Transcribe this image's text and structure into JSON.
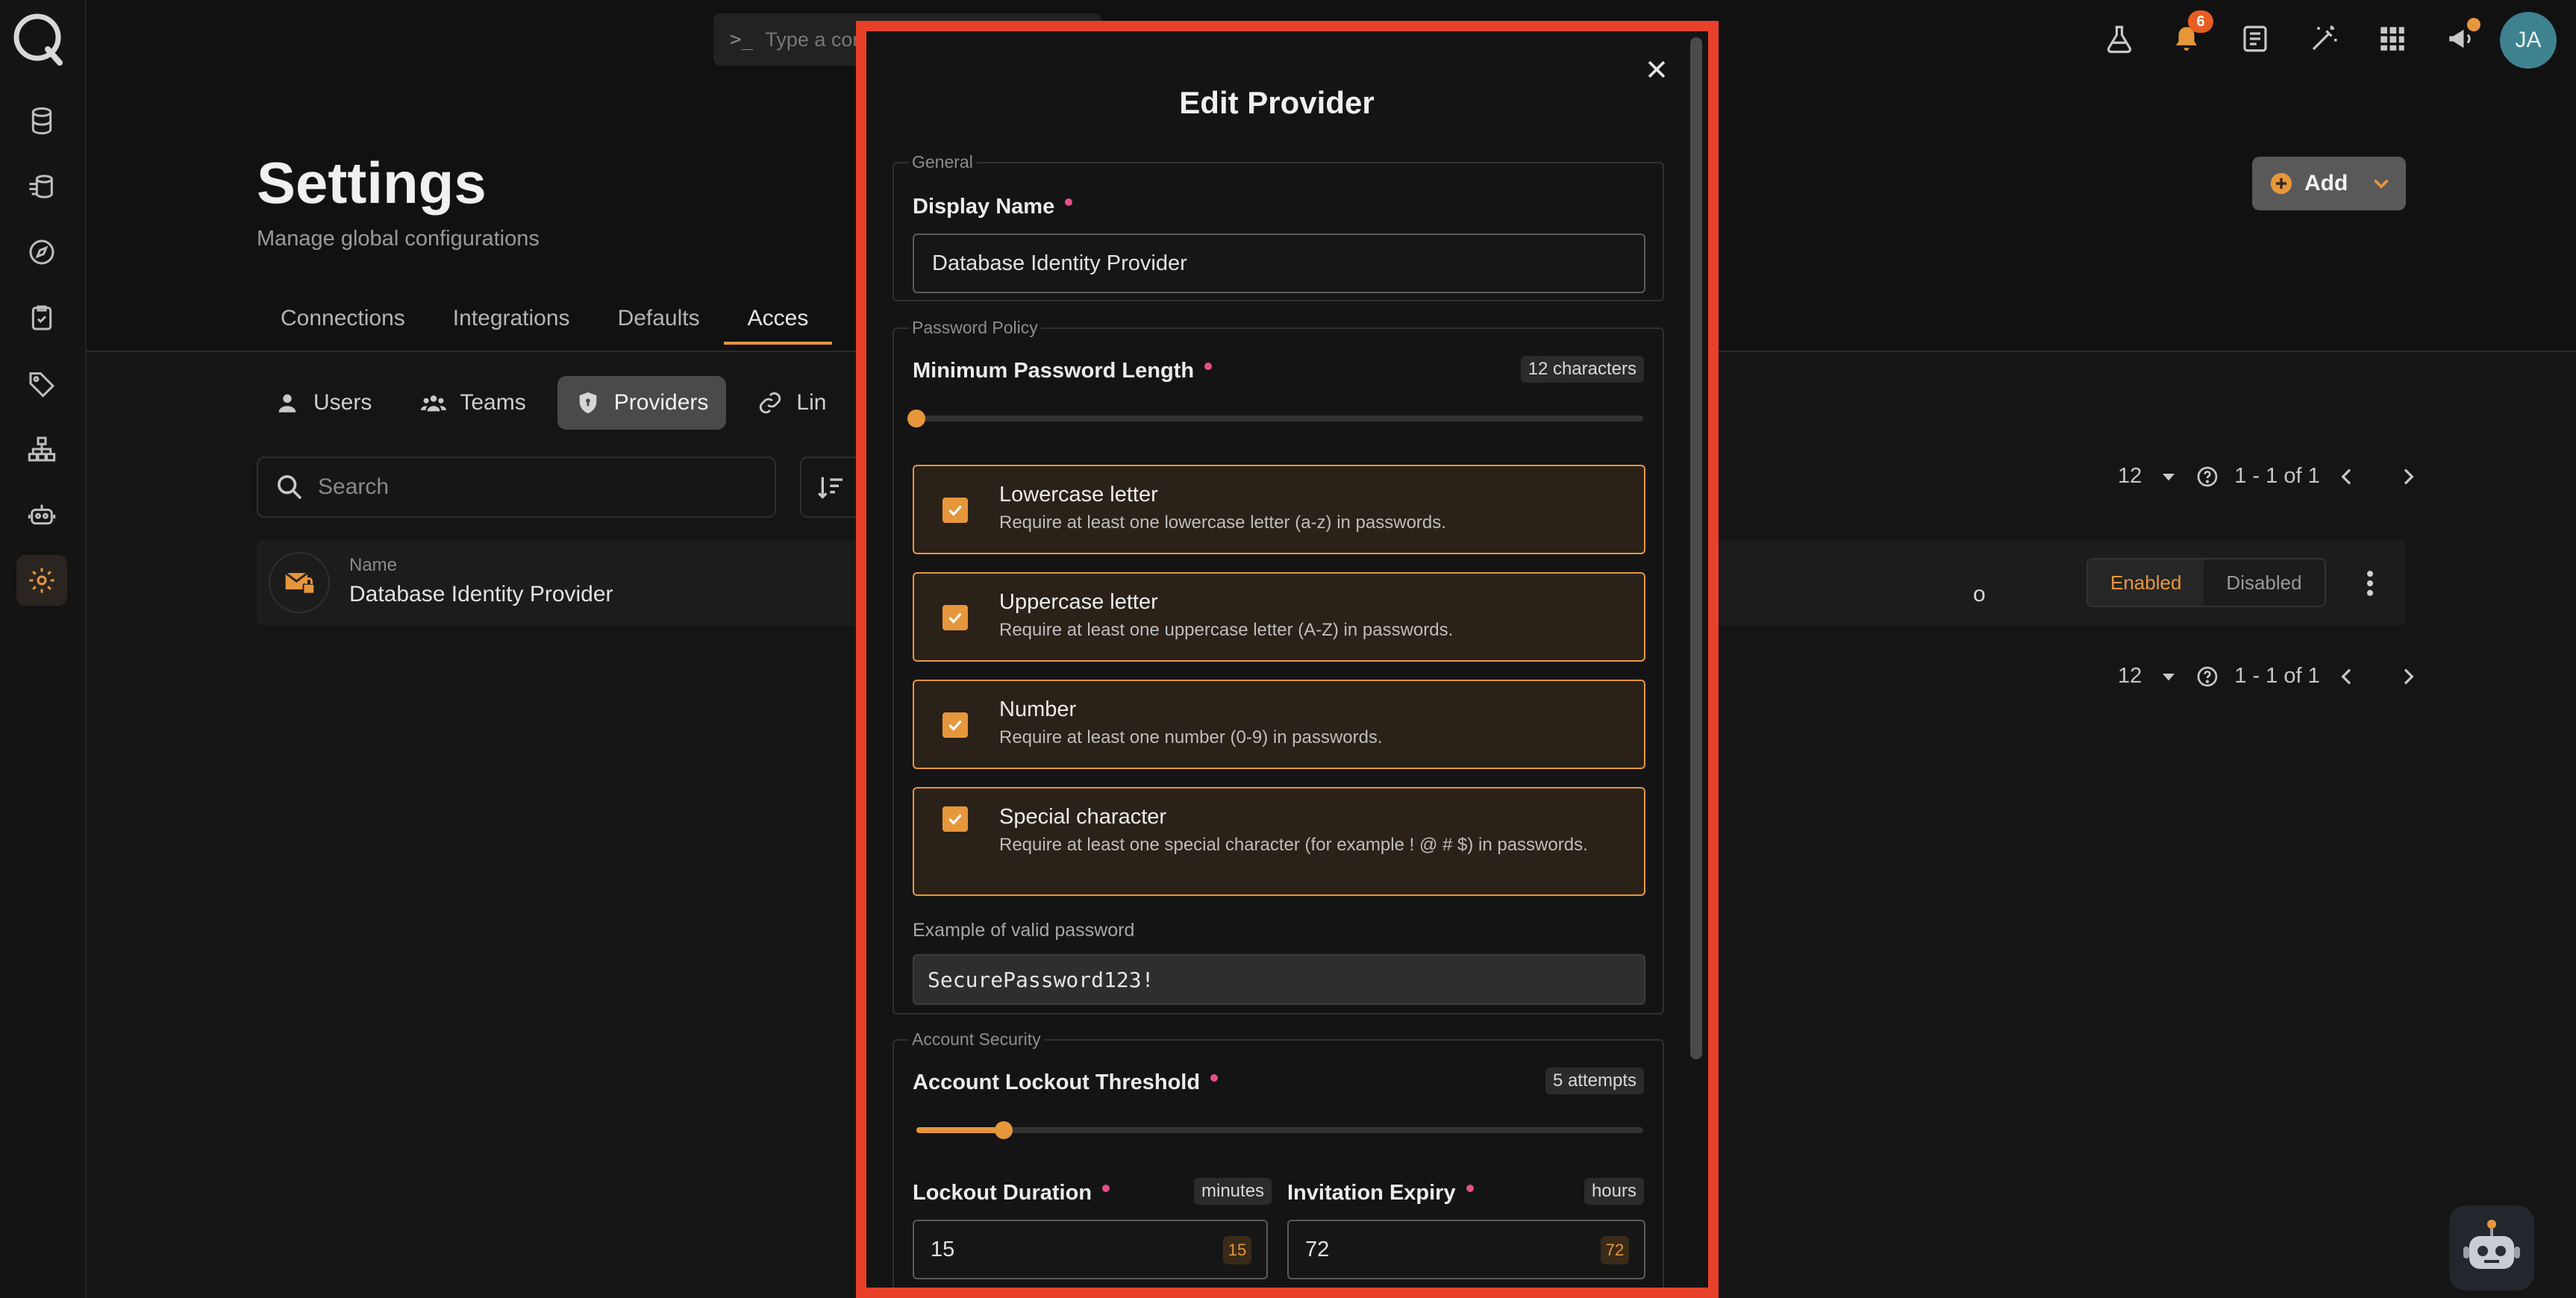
{
  "command_bar": {
    "placeholder": "Type a command..."
  },
  "topbar": {
    "notifications_count": "6",
    "avatar_initials": "JA"
  },
  "sidebar": {
    "items": [
      "database-icon",
      "ingest-icon",
      "compass-icon",
      "checklist-icon",
      "tag-icon",
      "hierarchy-icon",
      "robot-icon",
      "gear-icon"
    ],
    "active": "gear-icon"
  },
  "page": {
    "title": "Settings",
    "subtitle": "Manage global configurations",
    "add_label": "Add"
  },
  "tabs": [
    "Connections",
    "Integrations",
    "Defaults",
    "Acces"
  ],
  "subtabs": {
    "users": "Users",
    "teams": "Teams",
    "providers": "Providers",
    "links": "Lin"
  },
  "search": {
    "placeholder": "Search"
  },
  "pagination": {
    "page_size": "12",
    "range": "1 - 1 of 1"
  },
  "table": {
    "name_label": "Name",
    "name_value": "Database Identity Provider",
    "partial_value": "o",
    "status_enabled": "Enabled",
    "status_disabled": "Disabled"
  },
  "modal": {
    "title": "Edit Provider",
    "general": {
      "legend": "General",
      "display_name_label": "Display Name",
      "display_name_value": "Database Identity Provider"
    },
    "password_policy": {
      "legend": "Password Policy",
      "min_length_label": "Minimum Password Length",
      "min_length_chip": "12 characters",
      "min_length_fraction": 0.0,
      "rules": [
        {
          "title": "Lowercase letter",
          "description": "Require at least one lowercase letter (a-z) in passwords.",
          "checked": true
        },
        {
          "title": "Uppercase letter",
          "description": "Require at least one uppercase letter (A-Z) in passwords.",
          "checked": true
        },
        {
          "title": "Number",
          "description": "Require at least one number (0-9) in passwords.",
          "checked": true
        },
        {
          "title": "Special character",
          "description": "Require at least one special character (for example ! @ # $) in passwords.",
          "checked": true
        }
      ],
      "example_label": "Example of valid password",
      "example_value": "SecurePassword123!"
    },
    "account_security": {
      "legend": "Account Security",
      "lockout_threshold_label": "Account Lockout Threshold",
      "lockout_threshold_chip": "5 attempts",
      "lockout_threshold_fraction": 0.12,
      "lockout_duration_label": "Lockout Duration",
      "lockout_duration_unit": "minutes",
      "lockout_duration_value": "15",
      "lockout_duration_tag": "15",
      "invitation_expiry_label": "Invitation Expiry",
      "invitation_expiry_unit": "hours",
      "invitation_expiry_value": "72",
      "invitation_expiry_tag": "72"
    }
  },
  "colors": {
    "accent": "#e6973b",
    "highlight_outline": "#e8412a",
    "required": "#e6508a",
    "avatar": "#3e8290"
  }
}
